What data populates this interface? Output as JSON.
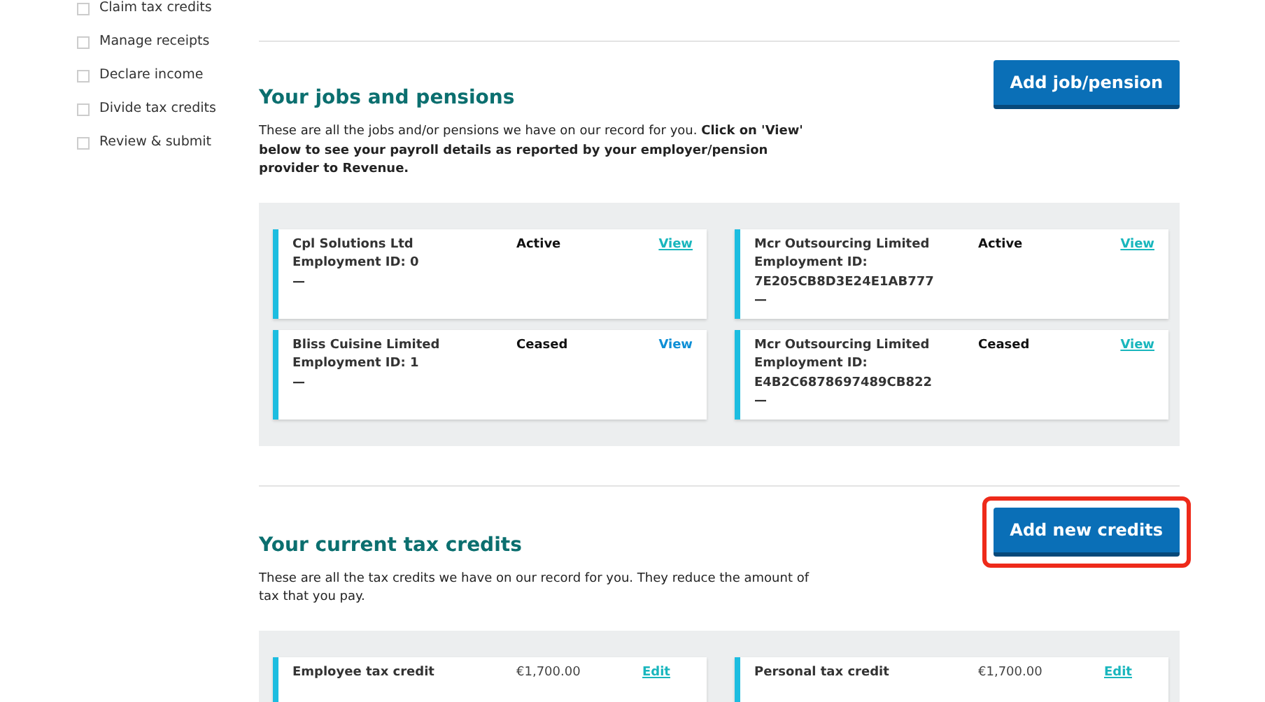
{
  "sidebar": {
    "items": [
      {
        "label": "Claim tax credits",
        "checked": false
      },
      {
        "label": "Manage receipts",
        "checked": false
      },
      {
        "label": "Declare income",
        "checked": false
      },
      {
        "label": "Divide tax credits",
        "checked": false
      },
      {
        "label": "Review & submit",
        "checked": false
      }
    ]
  },
  "jobs": {
    "title": "Your jobs and pensions",
    "button": {
      "label": "Add job/pension",
      "highlighted": false
    },
    "intro": "These are all the jobs and/or pensions we have on our record for you. **Click on 'View' below to see your payroll details as reported by your employer/pension provider to Revenue.**",
    "cards": [
      {
        "name": "Cpl Solutions Ltd",
        "id_label": "Employment ID: 0",
        "dash": "—",
        "status": "Active",
        "link": "View",
        "visited": true
      },
      {
        "name": "Mcr Outsourcing Limited",
        "id_label": "Employment ID: 7E205CB8D3E24E1AB777",
        "dash": "—",
        "status": "Active",
        "link": "View",
        "visited": true
      },
      {
        "name": "Bliss Cuisine Limited",
        "id_label": "Employment ID: 1",
        "dash": "—",
        "status": "Ceased",
        "link": "View",
        "visited": false
      },
      {
        "name": "Mcr Outsourcing Limited",
        "id_label": "Employment ID: E4B2C6878697489CB822",
        "dash": "—",
        "status": "Ceased",
        "link": "View",
        "visited": true
      }
    ]
  },
  "credits": {
    "title": "Your current tax credits",
    "button": {
      "label": "Add new credits",
      "highlighted": true
    },
    "intro": "These are all the tax credits we have on our record for you. They reduce the amount of tax that you pay.",
    "cards": [
      {
        "name": "Employee tax credit",
        "amount": "€1,700.00",
        "link": "Edit"
      },
      {
        "name": "Personal tax credit",
        "amount": "€1,700.00",
        "link": "Edit"
      }
    ]
  }
}
